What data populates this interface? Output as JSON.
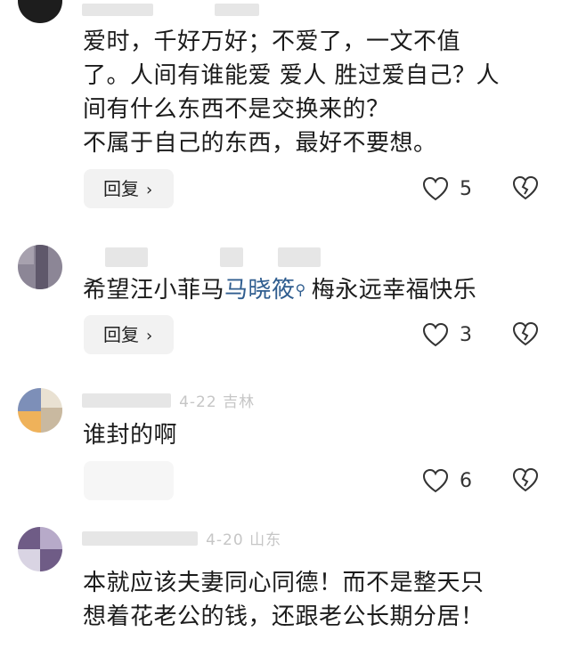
{
  "comments": [
    {
      "lines": [
        "爱时，千好万好；不爱了，一文不值",
        "了。人间有谁能爱 爱人 胜过爱自己？人",
        "间有什么东西不是交换来的？",
        "不属于自己的东西，最好不要想。"
      ],
      "reply_label": "回复",
      "likes": "5"
    },
    {
      "text_before": "希望汪小菲马",
      "link_text": "马晓筱",
      "text_after": "梅永远幸福快乐",
      "reply_label": "回复",
      "likes": "3"
    },
    {
      "meta_faint": "4-22 吉林",
      "lines": [
        "谁封的啊"
      ],
      "likes": "6"
    },
    {
      "meta_faint": "4-20 山东",
      "lines": [
        "本就应该夫妻同心同德！而不是整天只",
        "想着花老公的钱，还跟老公长期分居！"
      ]
    }
  ],
  "icons": {
    "like": "heart-outline-icon",
    "dislike": "broken-heart-icon",
    "search": "search-icon",
    "chevron": "chevron-right-icon"
  },
  "colors": {
    "link": "#2f5d8f",
    "button_bg": "#f2f2f2",
    "text": "#1b1b1b"
  }
}
